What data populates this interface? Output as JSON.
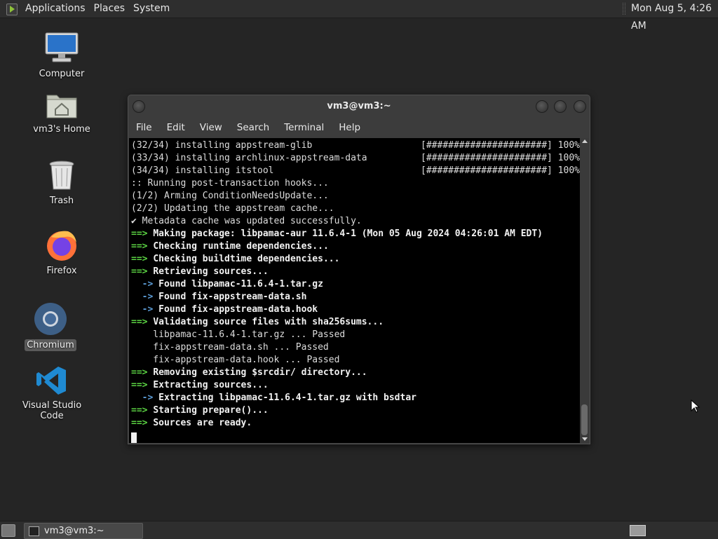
{
  "top_panel": {
    "menus": [
      "Applications",
      "Places",
      "System"
    ],
    "clock": "Mon Aug  5,  4:26 AM"
  },
  "desktop": {
    "icons": [
      {
        "label": "Computer",
        "icon": "computer-icon"
      },
      {
        "label": "vm3's Home",
        "icon": "home-folder-icon"
      },
      {
        "label": "Trash",
        "icon": "trash-icon"
      },
      {
        "label": "Firefox",
        "icon": "firefox-icon"
      },
      {
        "label": "Chromium",
        "icon": "chromium-icon",
        "selected": true
      },
      {
        "label": "Visual Studio Code",
        "icon": "vscode-icon"
      }
    ]
  },
  "terminal": {
    "title": "vm3@vm3:~",
    "menu": [
      "File",
      "Edit",
      "View",
      "Search",
      "Terminal",
      "Help"
    ],
    "lines": [
      {
        "text": "(32/34) installing appstream-glib",
        "progress": "[######################] 100%"
      },
      {
        "text": "(33/34) installing archlinux-appstream-data",
        "progress": "[######################] 100%"
      },
      {
        "text": "(34/34) installing itstool",
        "progress": "[######################] 100%"
      },
      {
        "text": ":: Running post-transaction hooks..."
      },
      {
        "text": "(1/2) Arming ConditionNeedsUpdate..."
      },
      {
        "text": "(2/2) Updating the appstream cache..."
      },
      {
        "text": "✔ Metadata cache was updated successfully."
      },
      {
        "prefix": "==> ",
        "text": "Making package: libpamac-aur 11.6.4-1 (Mon 05 Aug 2024 04:26:01 AM EDT)"
      },
      {
        "prefix": "==> ",
        "text": "Checking runtime dependencies..."
      },
      {
        "prefix": "==> ",
        "text": "Checking buildtime dependencies..."
      },
      {
        "prefix": "==> ",
        "text": "Retrieving sources..."
      },
      {
        "prefix": "  -> ",
        "text": "Found libpamac-11.6.4-1.tar.gz"
      },
      {
        "prefix": "  -> ",
        "text": "Found fix-appstream-data.sh"
      },
      {
        "prefix": "  -> ",
        "text": "Found fix-appstream-data.hook"
      },
      {
        "prefix": "==> ",
        "text": "Validating source files with sha256sums..."
      },
      {
        "text": "    libpamac-11.6.4-1.tar.gz ... Passed"
      },
      {
        "text": "    fix-appstream-data.sh ... Passed"
      },
      {
        "text": "    fix-appstream-data.hook ... Passed"
      },
      {
        "prefix": "==> ",
        "text": "Removing existing $srcdir/ directory..."
      },
      {
        "prefix": "==> ",
        "text": "Extracting sources..."
      },
      {
        "prefix": "  -> ",
        "text": "Extracting libpamac-11.6.4-1.tar.gz with bsdtar"
      },
      {
        "prefix": "==> ",
        "text": "Starting prepare()..."
      },
      {
        "prefix": "==> ",
        "text": "Sources are ready."
      }
    ]
  },
  "taskbar": {
    "window_button": "vm3@vm3:~"
  },
  "colors": {
    "desktop_bg": "#252525",
    "terminal_bg": "#000000",
    "arrow_green": "#5bd343",
    "panel_bg": "#2e2e2e"
  }
}
